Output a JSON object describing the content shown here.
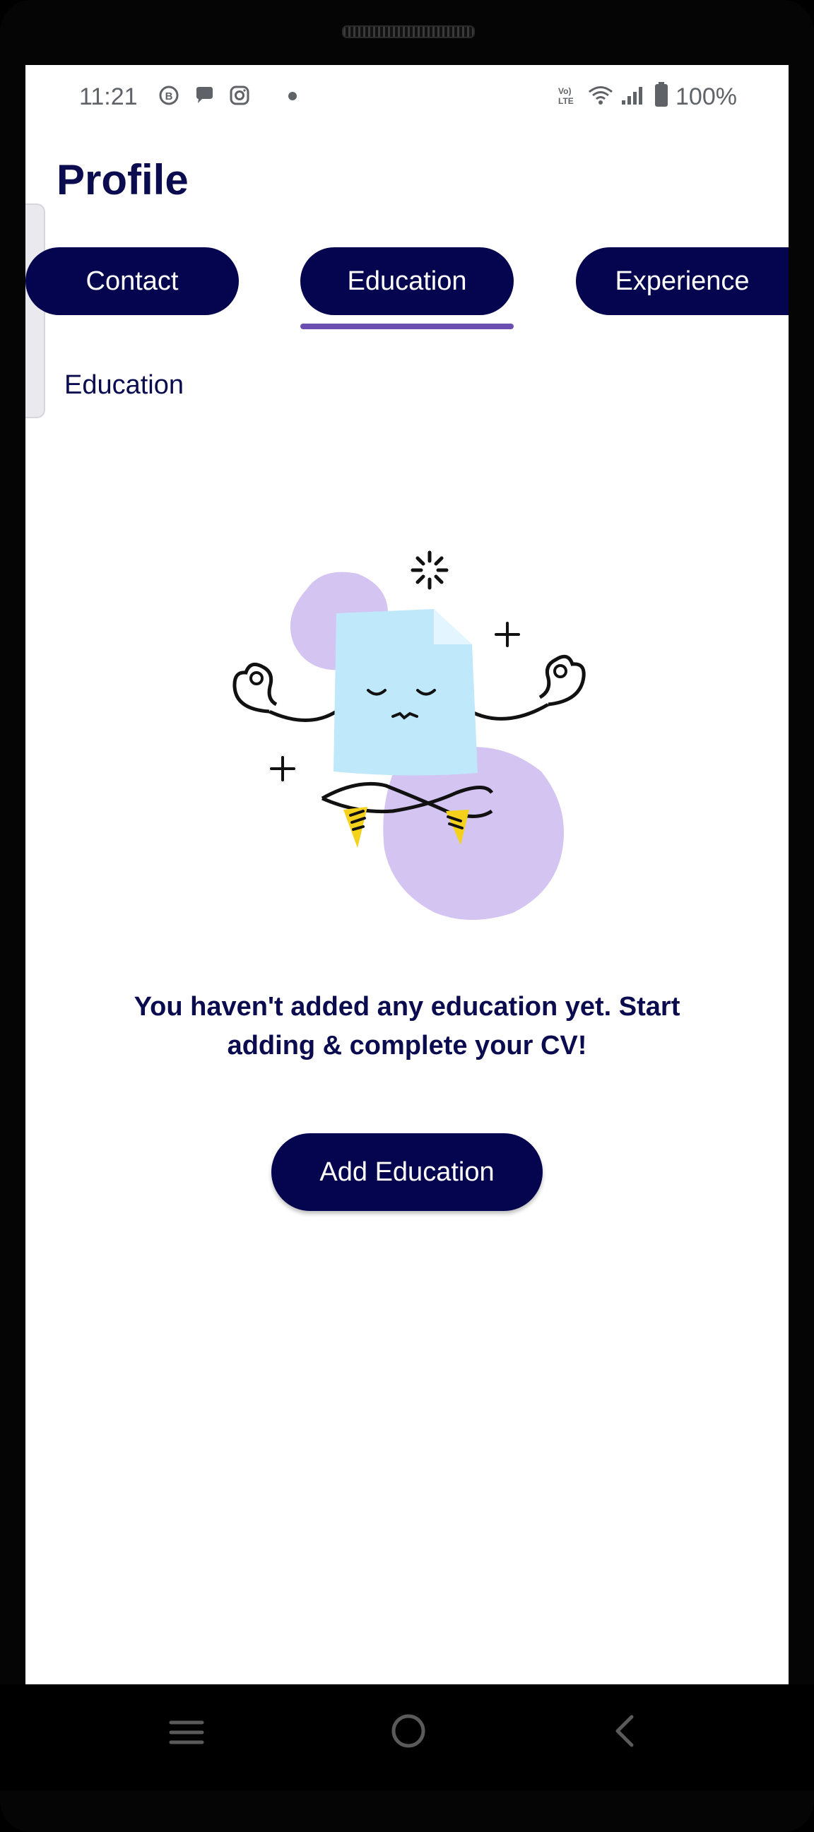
{
  "status_bar": {
    "time": "11:21",
    "notification_icons": [
      "b-circle-icon",
      "chat-bubble-icon",
      "instagram-icon"
    ],
    "battery_text": "100%",
    "signal_icons": [
      "volte-icon",
      "wifi-icon",
      "cell-signal-icon",
      "battery-icon"
    ]
  },
  "page": {
    "title": "Profile"
  },
  "tabs": [
    {
      "label": "Contact"
    },
    {
      "label": "Education",
      "selected": true
    },
    {
      "label": "Experience"
    }
  ],
  "section": {
    "label": "Education"
  },
  "empty_state": {
    "message": "You haven't added any education yet. Start adding & complete your CV!",
    "button_label": "Add Education"
  },
  "colors": {
    "primary": "#05054f",
    "indicator": "#6a4fb0",
    "blob": "#d3c4f2",
    "paper": "#bfe8fb",
    "shoe": "#f4d21c"
  },
  "nav_bar": {
    "buttons": [
      "menu-icon",
      "home-icon",
      "back-icon"
    ]
  }
}
